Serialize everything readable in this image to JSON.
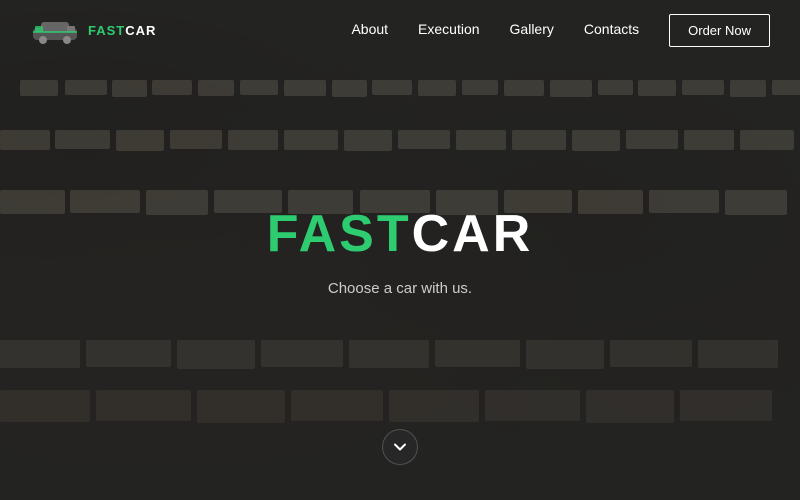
{
  "brand": {
    "fast": "FAST",
    "car": "CAR",
    "full": "FASTCAR",
    "logo_text_fast": "FAST",
    "logo_text_car": "CAR"
  },
  "hero": {
    "subtitle": "Choose a car with us."
  },
  "nav": {
    "links": [
      {
        "label": "About",
        "href": "#about"
      },
      {
        "label": "Execution",
        "href": "#execution"
      },
      {
        "label": "Gallery",
        "href": "#gallery"
      },
      {
        "label": "Contacts",
        "href": "#contacts"
      }
    ],
    "order_button": "Order Now"
  },
  "scroll_indicator": "❯",
  "colors": {
    "accent": "#2ecc71",
    "nav_bg": "rgba(15,15,15,0.75)",
    "overlay": "rgba(20,20,20,0.65)",
    "text_primary": "#ffffff",
    "text_muted": "#cccccc"
  }
}
